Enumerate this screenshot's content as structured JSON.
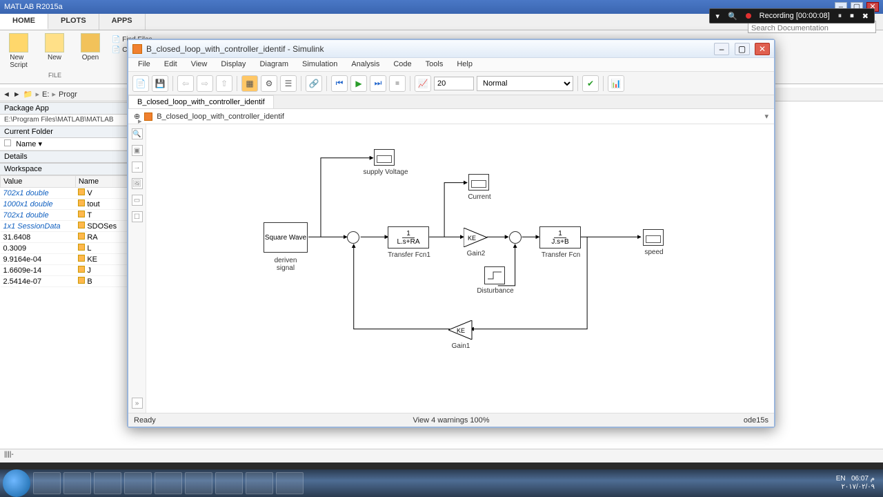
{
  "app_title": "MATLAB R2015a",
  "tabs": {
    "home": "HOME",
    "plots": "PLOTS",
    "apps": "APPS"
  },
  "ribbon": {
    "new_script": "New\nScript",
    "new": "New",
    "open": "Open",
    "find_files": "Find Files",
    "compare": "Compare",
    "group_file": "FILE",
    "package_app": "Package App"
  },
  "pathbar": {
    "drive": "E:",
    "seg1": "Progr",
    "ph": "Search Documentation"
  },
  "current_folder": {
    "label": "Current Folder",
    "name_col": "Name",
    "path_hint": "E:\\Program Files\\MATLAB\\MATLAB"
  },
  "details": {
    "label": "Details"
  },
  "workspace": {
    "label": "Workspace",
    "cols": {
      "value": "Value",
      "name": "Name"
    },
    "rows": [
      {
        "value": "702x1 double",
        "name": "V"
      },
      {
        "value": "1000x1 double",
        "name": "tout"
      },
      {
        "value": "702x1 double",
        "name": "T"
      },
      {
        "value": "1x1 SessionData",
        "name": "SDOSes"
      },
      {
        "value": "31.6408",
        "name": "RA"
      },
      {
        "value": "0.3009",
        "name": "L"
      },
      {
        "value": "9.9164e-04",
        "name": "KE"
      },
      {
        "value": "1.6609e-14",
        "name": "J"
      },
      {
        "value": "2.5414e-07",
        "name": "B"
      }
    ]
  },
  "recording": {
    "label": "Recording [00:00:08]"
  },
  "simulink": {
    "title": "B_closed_loop_with_controller_identif - Simulink",
    "menus": [
      "File",
      "Edit",
      "View",
      "Display",
      "Diagram",
      "Simulation",
      "Analysis",
      "Code",
      "Tools",
      "Help"
    ],
    "stop_time": "20",
    "mode": "Normal",
    "tab": "B_closed_loop_with_controller_identif",
    "crumb": "B_closed_loop_with_controller_identif",
    "status_left": "Ready",
    "status_mid": "View 4 warnings  100%",
    "status_right": "ode15s",
    "blocks": {
      "square": "Square Wave",
      "square_lbl": "deriven signal",
      "tf1_top": "1",
      "tf1_bot": "L.s+RA",
      "tf1_lbl": "Transfer Fcn1",
      "gain2": "KE",
      "gain2_lbl": "Gain2",
      "tf_top": "1",
      "tf_bot": "J.s+B",
      "tf_lbl": "Transfer Fcn",
      "gain1": "KE",
      "gain1_lbl": "Gain1",
      "supply_lbl": "supply Voltage",
      "current_lbl": "Current",
      "speed_lbl": "speed",
      "dist_lbl": "Disturbance"
    }
  },
  "tray": {
    "lang": "EN",
    "time": "06:07 م",
    "date": "٢٠١٧/٠٢/٠٩"
  }
}
